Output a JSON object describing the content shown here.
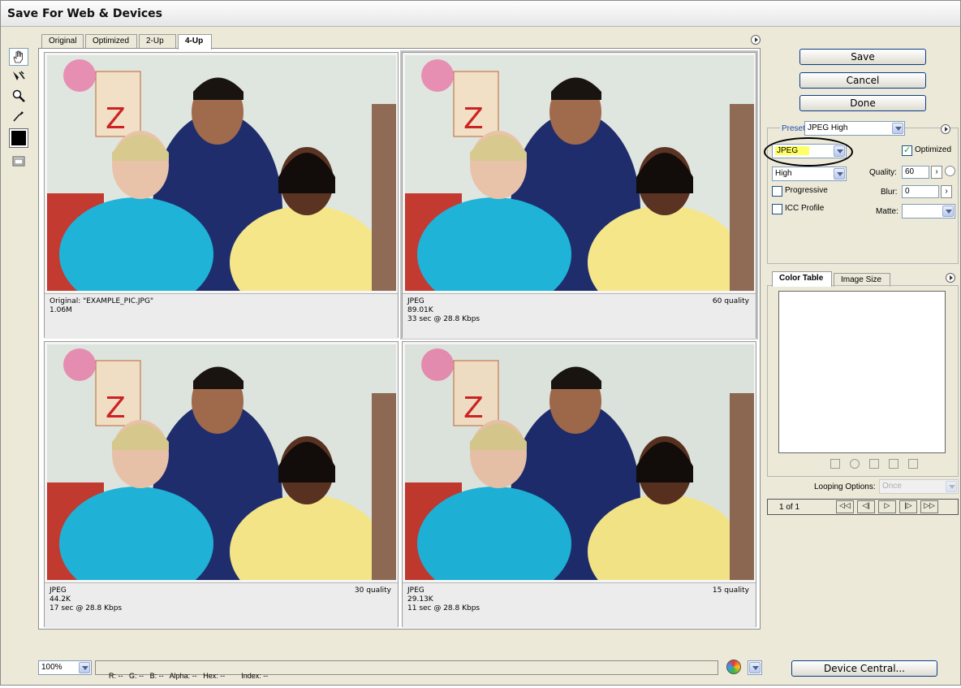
{
  "window": {
    "title": "Save For Web & Devices"
  },
  "tabs": [
    {
      "label": "Original"
    },
    {
      "label": "Optimized"
    },
    {
      "label": "2-Up"
    },
    {
      "label": "4-Up"
    }
  ],
  "tools": [
    "hand-tool-icon",
    "slice-select-icon",
    "zoom-icon",
    "eyedropper-icon",
    "eyedropper-color-swatch",
    "toggle-slices-icon"
  ],
  "panes": [
    {
      "line1": "Original: \"EXAMPLE_PIC.JPG\"",
      "line2": "1.06M",
      "line3": "",
      "quality": ""
    },
    {
      "line1": "JPEG",
      "line2": "89.01K",
      "line3": "33 sec @ 28.8 Kbps",
      "quality": "60 quality"
    },
    {
      "line1": "JPEG",
      "line2": "44.2K",
      "line3": "17 sec @ 28.8 Kbps",
      "quality": "30 quality"
    },
    {
      "line1": "JPEG",
      "line2": "29.13K",
      "line3": "11 sec @ 28.8 Kbps",
      "quality": "15 quality"
    }
  ],
  "actions": {
    "save": "Save",
    "cancel": "Cancel",
    "done": "Done",
    "device_central": "Device Central..."
  },
  "settings": {
    "preset_label": "Preset:",
    "preset_value": "JPEG High",
    "format_value": "JPEG",
    "optimized_label": "Optimized",
    "optimized_checked": true,
    "quality_level": "High",
    "quality_label": "Quality:",
    "quality_value": "60",
    "progressive_label": "Progressive",
    "blur_label": "Blur:",
    "blur_value": "0",
    "icc_label": "ICC Profile",
    "matte_label": "Matte:",
    "matte_value": ""
  },
  "color_panel": {
    "tab_color_table": "Color Table",
    "tab_image_size": "Image Size",
    "looping_label": "Looping Options:",
    "looping_value": "Once",
    "frame_counter": "1 of 1"
  },
  "status": {
    "zoom": "100%",
    "r": "R:",
    "r_val": "--",
    "g": "G:",
    "g_val": "--",
    "b": "B:",
    "b_val": "--",
    "alpha": "Alpha:",
    "alpha_val": "--",
    "hex": "Hex:",
    "hex_val": "--",
    "index": "Index:",
    "index_val": "--"
  },
  "colors": {
    "format_highlight": "#ffff66",
    "annotation_circle": "#000000"
  }
}
